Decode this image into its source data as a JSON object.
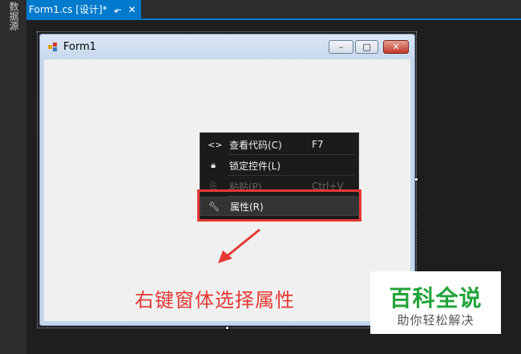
{
  "side_panel": {
    "label": "数据源"
  },
  "document_tab": {
    "title": "Form1.cs [设计]*",
    "pin_icon": "pin-icon",
    "close_icon": "close-icon"
  },
  "form": {
    "title": "Form1",
    "buttons": {
      "minimize": "minimize-icon",
      "maximize": "maximize-icon",
      "close": "close-icon"
    }
  },
  "context_menu": {
    "items": [
      {
        "icon": "code-icon",
        "label": "查看代码(C)",
        "shortcut": "F7",
        "enabled": true
      },
      {
        "icon": "lock-icon",
        "label": "锁定控件(L)",
        "shortcut": "",
        "enabled": true
      },
      {
        "icon": "paste-icon",
        "label": "粘贴(P)",
        "shortcut": "Ctrl+V",
        "enabled": false
      },
      {
        "icon": "wrench-icon",
        "label": "属性(R)",
        "shortcut": "",
        "enabled": true,
        "highlighted": true
      }
    ]
  },
  "annotation": {
    "text": "右键窗体选择属性",
    "color": "#e53935"
  },
  "watermark": {
    "main": "百科全说",
    "sub": "助你轻松解决",
    "color": "#22a33a"
  },
  "colors": {
    "accent": "#007acc",
    "ide_background": "#2d2d30",
    "form_client": "#f0f0f0"
  }
}
